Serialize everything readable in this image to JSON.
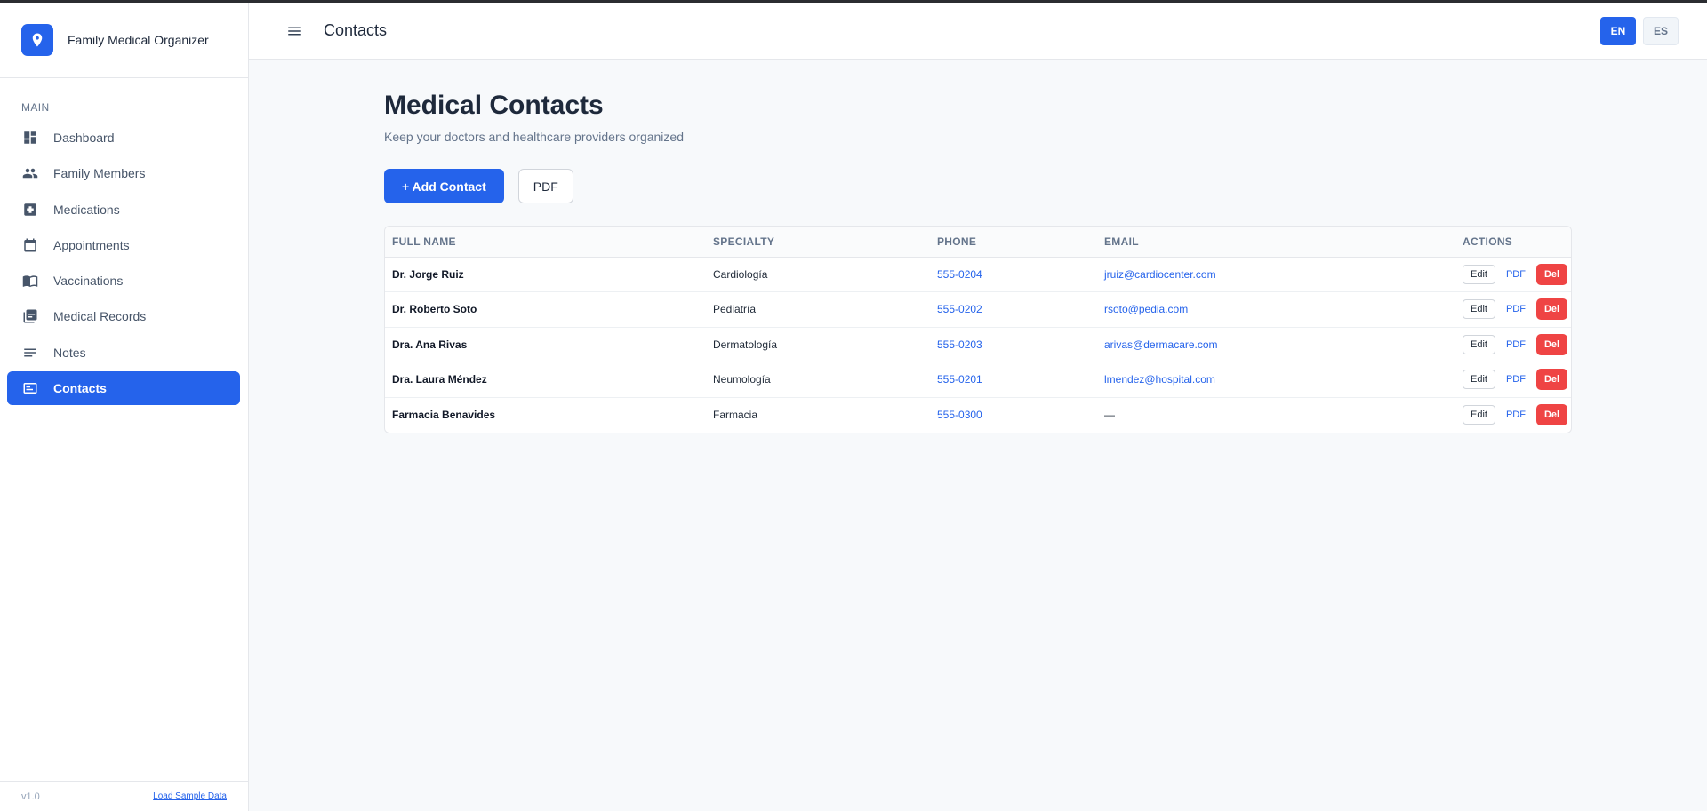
{
  "app": {
    "name": "Family Medical Organizer",
    "version": "v1.0",
    "load_sample": "Load Sample Data"
  },
  "sidebar": {
    "section": "MAIN",
    "items": [
      {
        "label": "Dashboard",
        "icon": "dashboard-icon"
      },
      {
        "label": "Family Members",
        "icon": "people-icon"
      },
      {
        "label": "Medications",
        "icon": "medical-cross-icon"
      },
      {
        "label": "Appointments",
        "icon": "calendar-icon"
      },
      {
        "label": "Vaccinations",
        "icon": "book-icon"
      },
      {
        "label": "Medical Records",
        "icon": "records-icon"
      },
      {
        "label": "Notes",
        "icon": "notes-icon"
      },
      {
        "label": "Contacts",
        "icon": "contacts-icon",
        "active": true
      }
    ]
  },
  "header": {
    "title": "Contacts",
    "lang_en": "EN",
    "lang_es": "ES"
  },
  "main": {
    "title": "Medical Contacts",
    "subtitle": "Keep your doctors and healthcare providers organized",
    "add_button": "+ Add Contact",
    "pdf_button": "PDF"
  },
  "table": {
    "headers": {
      "name": "FULL NAME",
      "specialty": "SPECIALTY",
      "phone": "PHONE",
      "email": "EMAIL",
      "actions": "ACTIONS"
    },
    "action_labels": {
      "edit": "Edit",
      "pdf": "PDF",
      "del": "Del"
    },
    "rows": [
      {
        "name": "Dr. Jorge Ruiz",
        "specialty": "Cardiología",
        "phone": "555-0204",
        "email": "jruiz@cardiocenter.com"
      },
      {
        "name": "Dr. Roberto Soto",
        "specialty": "Pediatría",
        "phone": "555-0202",
        "email": "rsoto@pedia.com"
      },
      {
        "name": "Dra. Ana Rivas",
        "specialty": "Dermatología",
        "phone": "555-0203",
        "email": "arivas@dermacare.com"
      },
      {
        "name": "Dra. Laura Méndez",
        "specialty": "Neumología",
        "phone": "555-0201",
        "email": "lmendez@hospital.com"
      },
      {
        "name": "Farmacia Benavides",
        "specialty": "Farmacia",
        "phone": "555-0300",
        "email": "—"
      }
    ]
  },
  "colors": {
    "accent": "#2563eb",
    "danger": "#ef4444"
  }
}
